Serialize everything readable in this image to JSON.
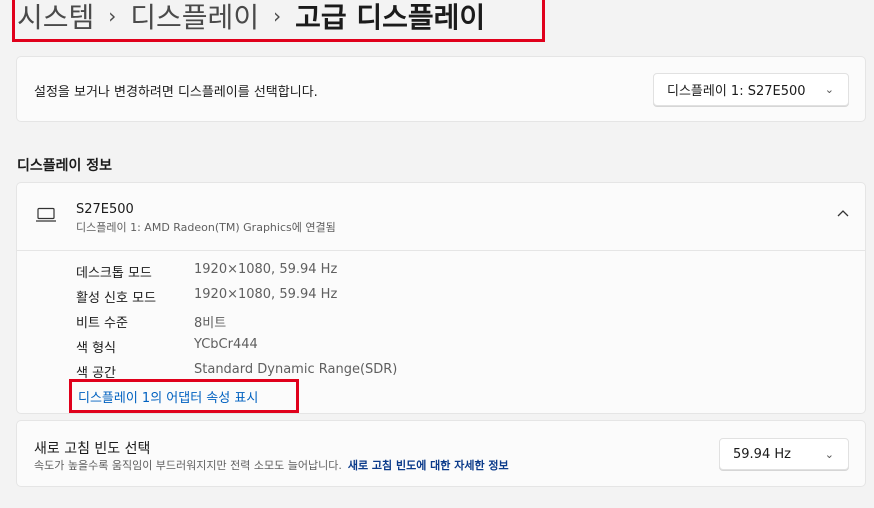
{
  "breadcrumb": {
    "items": [
      "시스템",
      "디스플레이"
    ],
    "current": "고급 디스플레이",
    "separator": "›"
  },
  "display_select": {
    "label": "설정을 보거나 변경하려면 디스플레이를 선택합니다.",
    "value": "디스플레이 1: S27E500",
    "chevron": "chevron-down-icon"
  },
  "display_info": {
    "section_title": "디스플레이 정보",
    "name": "S27E500",
    "subtitle": "디스플레이 1: AMD Radeon(TM) Graphics에 연결됨",
    "specs": [
      {
        "key": "데스크톱 모드",
        "value": "1920×1080, 59.94 Hz"
      },
      {
        "key": "활성 신호 모드",
        "value": "1920×1080, 59.94 Hz"
      },
      {
        "key": "비트 수준",
        "value": "8비트"
      },
      {
        "key": "색 형식",
        "value": "YCbCr444"
      },
      {
        "key": "색 공간",
        "value": "Standard Dynamic Range(SDR)"
      }
    ],
    "adapter_link": "디스플레이 1의 어댑터 속성 표시"
  },
  "refresh": {
    "title": "새로 고침 빈도 선택",
    "description": "속도가 높을수록 움직임이 부드러워지지만 전력 소모도 늘어납니다.",
    "link": "새로 고침 빈도에 대한 자세한 정보",
    "value": "59.94 Hz"
  },
  "colors": {
    "highlight_border": "#e0001b",
    "link": "#0061c0"
  }
}
